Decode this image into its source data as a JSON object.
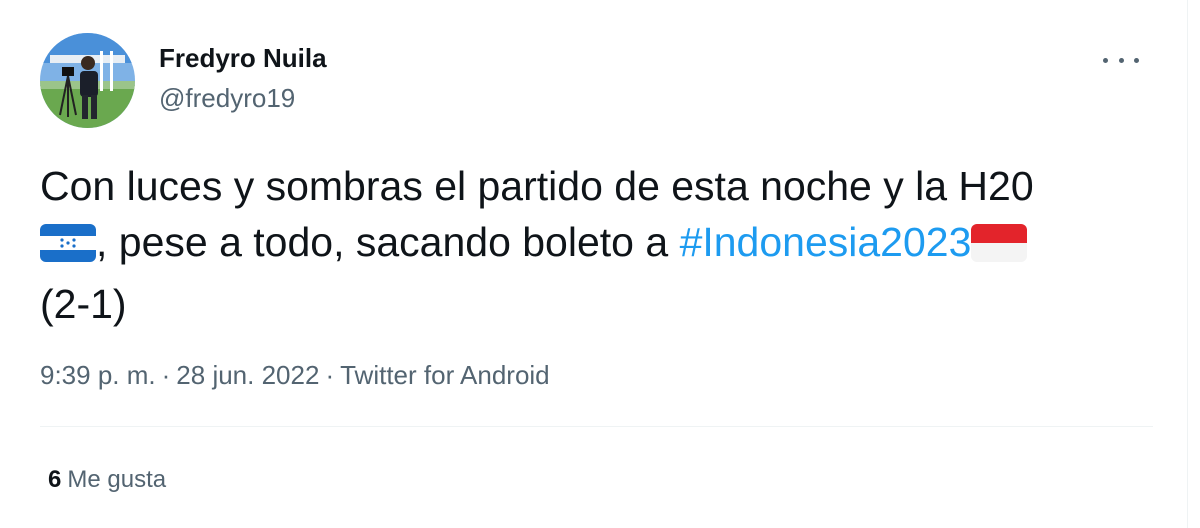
{
  "author": {
    "display_name": "Fredyro Nuila",
    "handle": "@fredyro19"
  },
  "tweet": {
    "text_line1": "Con luces y sombras el partido de esta noche y la H20",
    "text_line2_after_flag": ", pese a todo, sacando boleto a ",
    "hashtag": "#Indonesia2023",
    "text_line3": "(2-1)",
    "emoji_flags": [
      "honduras-flag",
      "indonesia-flag"
    ]
  },
  "meta": {
    "time": "9:39 p. m.",
    "separator": "·",
    "date": "28 jun. 2022",
    "source": "Twitter for Android"
  },
  "stats": {
    "likes_count": "6",
    "likes_label": "Me gusta"
  },
  "colors": {
    "link": "#1d9bf0",
    "secondary_text": "#536471",
    "primary_text": "#0f1419"
  },
  "icons": {
    "more": "more-options-icon"
  }
}
